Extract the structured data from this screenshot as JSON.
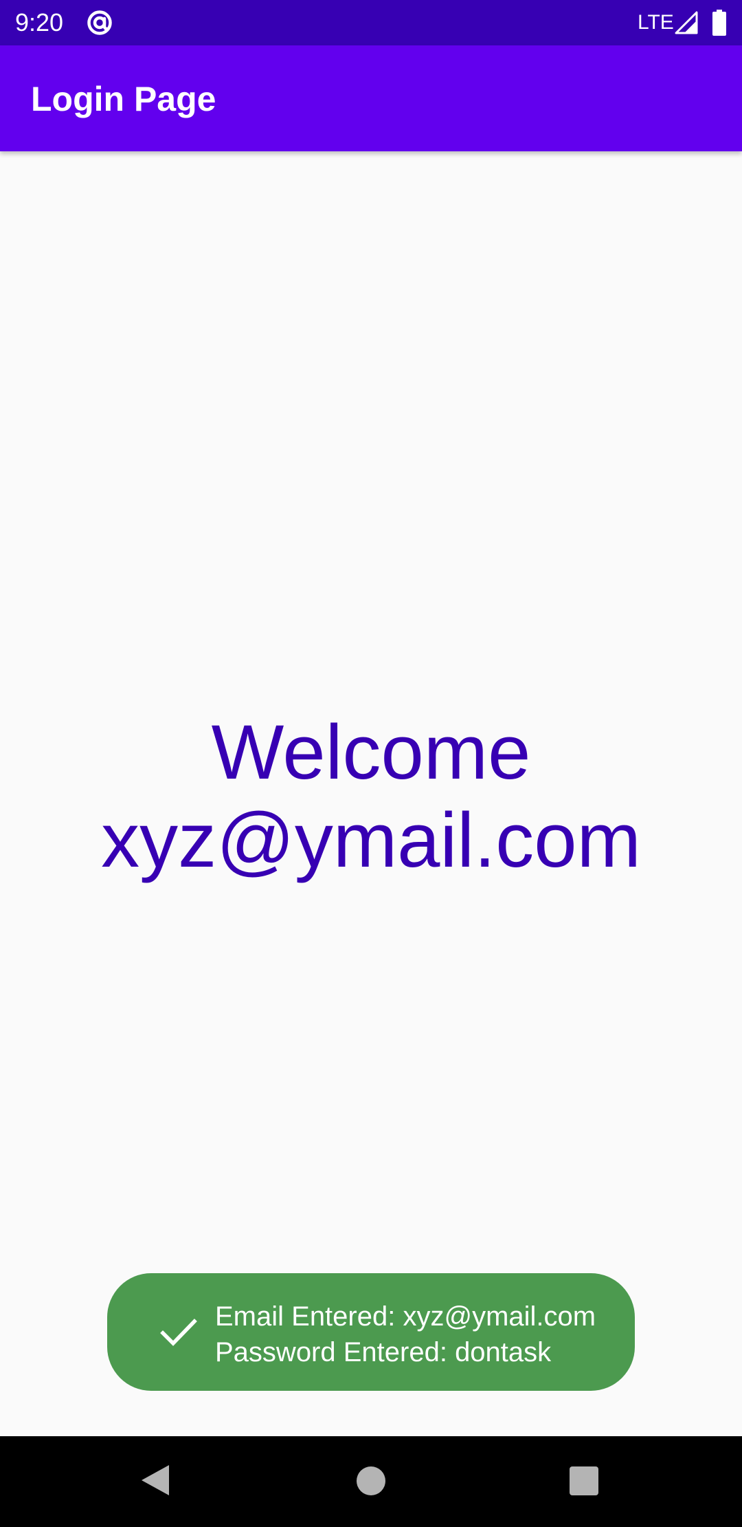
{
  "status_bar": {
    "time": "9:20",
    "network": "LTE",
    "app_icon": "at-sign-icon",
    "signal_icon": "signal-icon",
    "battery_icon": "battery-icon"
  },
  "app_bar": {
    "title": "Login Page"
  },
  "main": {
    "welcome_line1": "Welcome",
    "welcome_line2": "xyz@ymail.com"
  },
  "snackbar": {
    "icon": "check-icon",
    "line1": "Email Entered: xyz@ymail.com",
    "line2": "Password Entered: dontask"
  },
  "nav_bar": {
    "back_icon": "back-icon",
    "home_icon": "home-icon",
    "recents_icon": "recents-icon"
  },
  "colors": {
    "status_bar": "#3700b3",
    "app_bar": "#6200ee",
    "welcome_text": "#3700b3",
    "snackbar": "#4c9a4f",
    "background": "#fafafa"
  }
}
